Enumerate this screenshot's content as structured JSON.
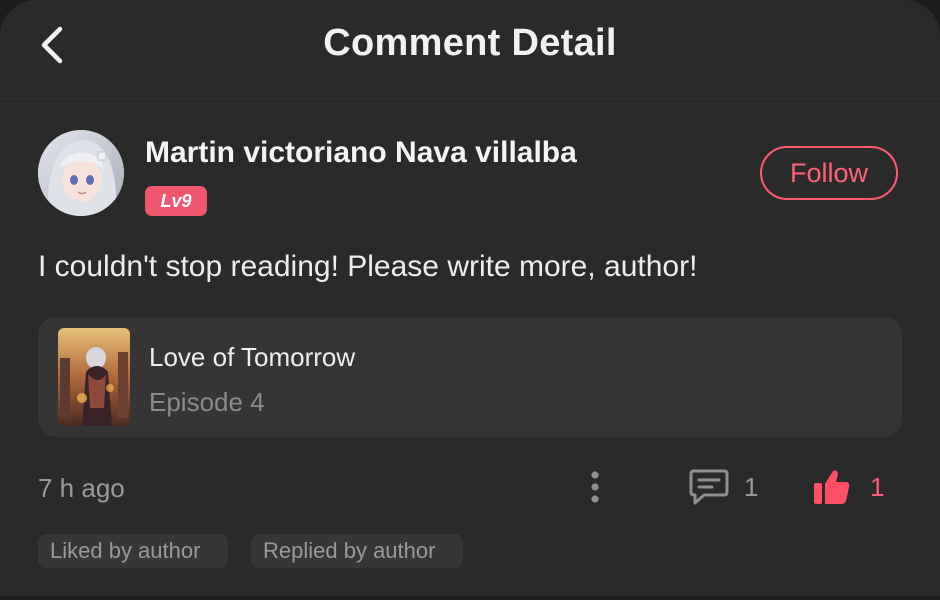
{
  "header": {
    "title": "Comment Detail",
    "back_icon": "chevron-left-icon"
  },
  "comment": {
    "user": {
      "name": "Martin victoriano Nava villalba",
      "level": "Lv9",
      "avatar": "anime-girl-avatar"
    },
    "follow_label": "Follow",
    "text": "I couldn't stop reading! Please write more, author!",
    "book": {
      "title": "Love of Tomorrow",
      "episode": "Episode 4",
      "cover": "book-cover-image"
    },
    "time": "7 h ago",
    "replies": "1",
    "likes": "1",
    "tags": [
      "Liked by author",
      "Replied by author"
    ]
  },
  "colors": {
    "background": "#2a2a2a",
    "accent": "#ff5a72",
    "text_primary": "#f2f2f2",
    "text_secondary": "#9a9a9a",
    "card": "#353535"
  }
}
